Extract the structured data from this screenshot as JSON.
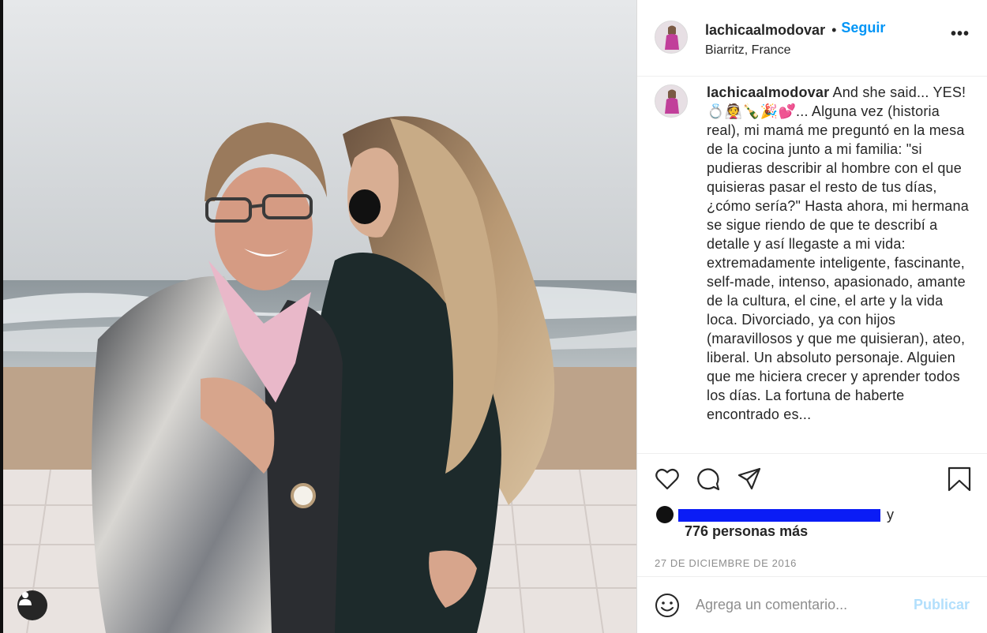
{
  "header": {
    "username": "lachicaalmodovar",
    "dot": "•",
    "follow_label": "Seguir",
    "location": "Biarritz, France",
    "more_label": "•••"
  },
  "caption": {
    "username": "lachicaalmodovar",
    "text": " And she said... YES! 💍👰🍾🎉💕... Alguna vez (historia real), mi mamá me preguntó en la mesa de la cocina junto a mi familia: \"si pudieras describir al hombre con el que quisieras pasar el resto de tus días, ¿cómo sería?\" Hasta ahora, mi hermana se sigue riendo de que te describí a detalle y así llegaste a mi vida: extremadamente inteligente, fascinante, self-made, intenso, apasionado, amante de la cultura, el cine, el arte y la vida loca. Divorciado, ya con hijos (maravillosos y que me quisieran), ateo, liberal. Un absoluto personaje. Alguien que me hiciera crecer y aprender todos los días. La fortuna de haberte encontrado es..."
  },
  "actions": {
    "like_icon": "heart-icon",
    "comment_icon": "comment-icon",
    "share_icon": "share-icon",
    "save_icon": "bookmark-icon"
  },
  "likes": {
    "and_label": "y",
    "others": "776 personas más"
  },
  "date": "27 DE DICIEMBRE DE 2016",
  "comment": {
    "placeholder": "Agrega un comentario...",
    "publish_label": "Publicar"
  },
  "colors": {
    "accent": "#0095f6",
    "publish_disabled": "#b2dffc",
    "redaction": "#0a1cf6"
  }
}
